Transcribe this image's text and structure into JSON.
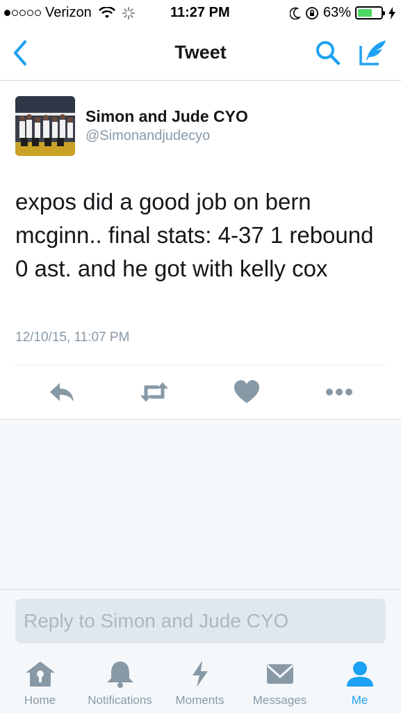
{
  "status_bar": {
    "carrier": "Verizon",
    "time": "11:27 PM",
    "battery_percent": "63%",
    "battery_level": 0.63,
    "signal_bars": 1
  },
  "nav": {
    "title": "Tweet",
    "back_icon": "chevron-left-icon",
    "search_icon": "search-icon",
    "compose_icon": "compose-tweet-icon"
  },
  "tweet": {
    "user_name": "Simon and Jude CYO",
    "handle": "@Simonandjudecyo",
    "text": "expos did a good job on bern mcginn.. final stats: 4-37 1 rebound 0 ast. and he got with kelly cox",
    "timestamp": "12/10/15, 11:07 PM",
    "actions": [
      "reply-icon",
      "retweet-icon",
      "like-icon",
      "more-icon"
    ]
  },
  "reply": {
    "placeholder": "Reply to Simon and Jude CYO"
  },
  "tabs": [
    {
      "label": "Home",
      "icon": "home-icon",
      "active": false
    },
    {
      "label": "Notifications",
      "icon": "bell-icon",
      "active": false
    },
    {
      "label": "Moments",
      "icon": "lightning-icon",
      "active": false
    },
    {
      "label": "Messages",
      "icon": "envelope-icon",
      "active": false
    },
    {
      "label": "Me",
      "icon": "person-icon",
      "active": true
    }
  ],
  "colors": {
    "accent": "#1da1f2",
    "icon_gray": "#8899a6",
    "text": "#14171a"
  }
}
